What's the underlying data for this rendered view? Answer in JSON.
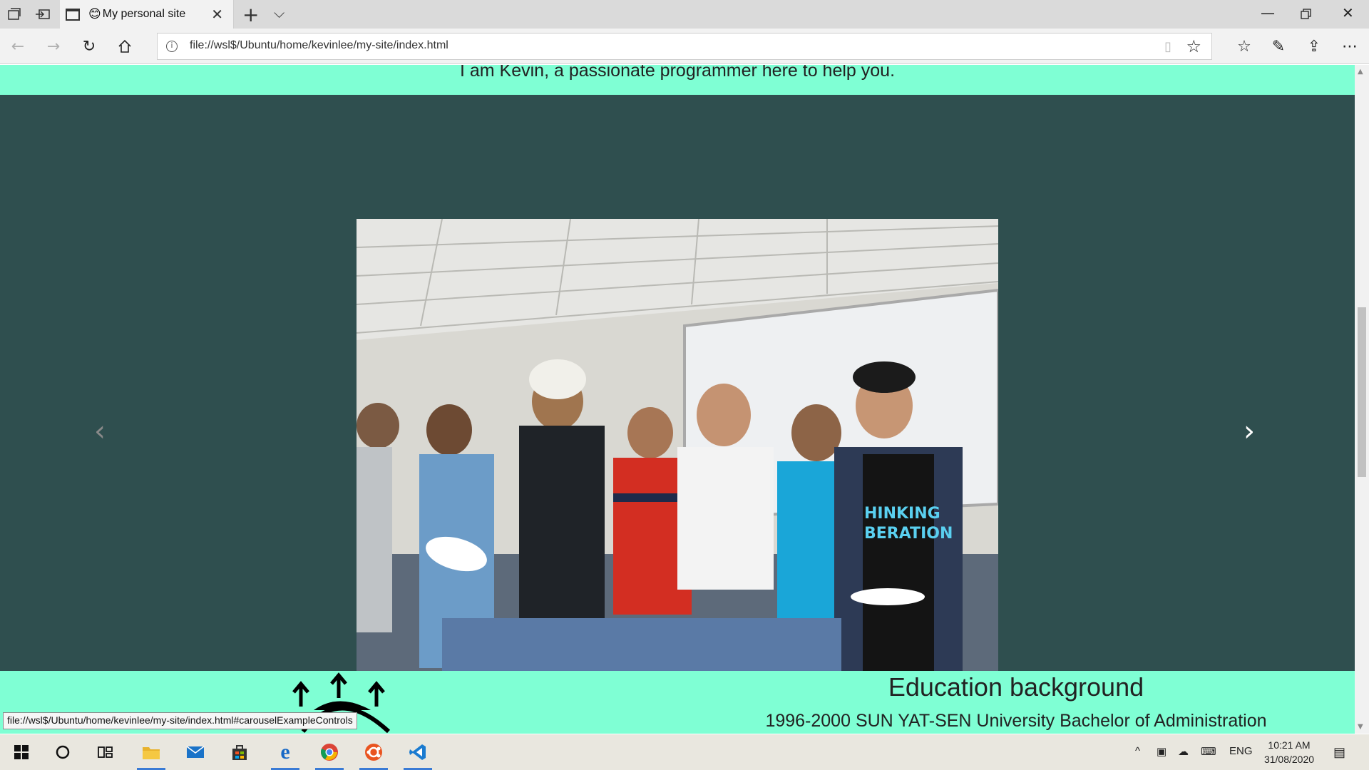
{
  "browser": {
    "tab": {
      "favicon": "😊",
      "title": "My personal site"
    },
    "url": "file://wsl$/Ubuntu/home/kevinlee/my-site/index.html",
    "icons": [
      "tab-manager-icon",
      "set-aside-tabs-icon",
      "tab-page-icon",
      "close-icon",
      "new-tab-icon",
      "tab-menu-icon",
      "minimize-icon",
      "restore-icon",
      "window-close-icon",
      "back-icon",
      "forward-icon",
      "refresh-icon",
      "home-icon",
      "info-icon",
      "reading-view-icon",
      "favorite-star-icon",
      "favorites-icon",
      "pen-icon",
      "share-icon",
      "more-icon"
    ]
  },
  "page": {
    "intro_text": "I am Kevin, a passionate programmer here to help you.",
    "carousel": {
      "prev_icon": "chevron-left-icon",
      "next_icon": "chevron-right-icon"
    },
    "education": {
      "title": "Education background",
      "line": "1996-2000 SUN YAT-SEN University Bachelor of Administration"
    },
    "status_tip": "file://wsl$/Ubuntu/home/kevinlee/my-site/index.html#carouselExampleControls"
  },
  "taskbar": {
    "apps": [
      "windows-start-icon",
      "cortana-icon",
      "task-view-icon",
      "file-explorer-icon",
      "mail-icon",
      "store-icon",
      "edge-icon",
      "chrome-icon",
      "ubuntu-icon",
      "vscode-icon"
    ],
    "language": "ENG",
    "time": "10:21 AM",
    "date": "31/08/2020"
  },
  "colors": {
    "aquamarine": "#7fffd4",
    "dark_slate": "#2f4f4f",
    "taskbar_accent": "#3a7bd5"
  }
}
